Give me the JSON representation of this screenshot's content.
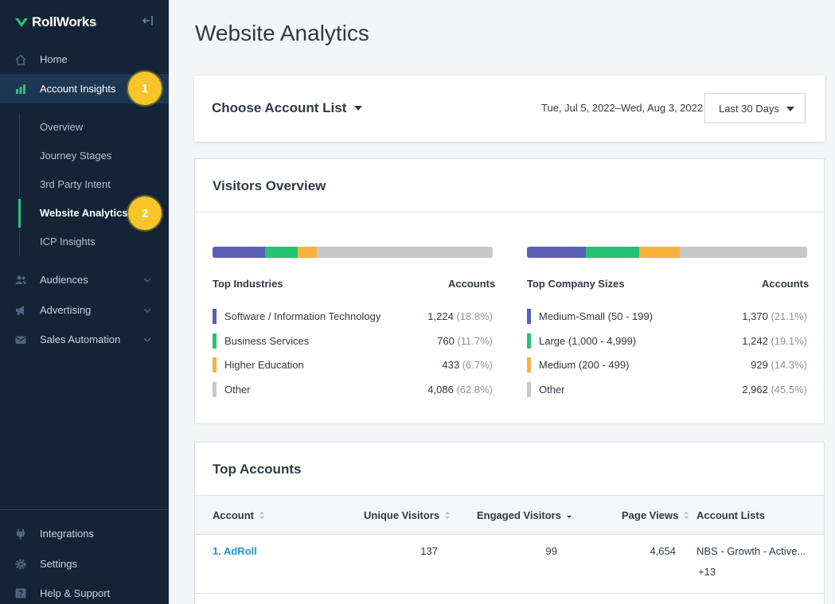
{
  "brand": {
    "name": "RollWorks",
    "accent": "#2ec27e",
    "sidebar_bg": "#142436"
  },
  "sidebar": {
    "items": [
      {
        "label": "Home",
        "icon": "home-icon"
      },
      {
        "label": "Account Insights",
        "icon": "chart-icon"
      },
      {
        "label": "Audiences",
        "icon": "people-icon"
      },
      {
        "label": "Advertising",
        "icon": "megaphone-icon"
      },
      {
        "label": "Sales Automation",
        "icon": "mail-icon"
      }
    ],
    "sub_items": [
      "Overview",
      "Journey Stages",
      "3rd Party Intent",
      "Website Analytics",
      "ICP Insights"
    ],
    "bottom_items": [
      {
        "label": "Integrations",
        "icon": "plug-icon"
      },
      {
        "label": "Settings",
        "icon": "gear-icon"
      },
      {
        "label": "Help & Support",
        "icon": "help-icon"
      }
    ],
    "badges": [
      "1",
      "2"
    ]
  },
  "page": {
    "title": "Website Analytics"
  },
  "filter": {
    "choose_label": "Choose Account List",
    "date_range": "Tue, Jul 5, 2022–Wed, Aug 3, 2022",
    "period": "Last 30 Days"
  },
  "visitors": {
    "title": "Visitors Overview",
    "industries": {
      "header": "Top Industries",
      "col": "Accounts",
      "rows": [
        {
          "label": "Software / Information Technology",
          "value": "1,224",
          "pct": "(18.8%)",
          "share": 18.8,
          "color": "#5b5fb6"
        },
        {
          "label": "Business Services",
          "value": "760",
          "pct": "(11.7%)",
          "share": 11.7,
          "color": "#22c472"
        },
        {
          "label": "Higher Education",
          "value": "433",
          "pct": "(6.7%)",
          "share": 6.7,
          "color": "#f8b23b"
        },
        {
          "label": "Other",
          "value": "4,086",
          "pct": "(62.8%)",
          "share": 62.8,
          "color": "#c8c8c8"
        }
      ]
    },
    "sizes": {
      "header": "Top Company Sizes",
      "col": "Accounts",
      "rows": [
        {
          "label": "Medium-Small (50 - 199)",
          "value": "1,370",
          "pct": "(21.1%)",
          "share": 21.1,
          "color": "#5b5fb6"
        },
        {
          "label": "Large (1,000 - 4,999)",
          "value": "1,242",
          "pct": "(19.1%)",
          "share": 19.1,
          "color": "#22c472"
        },
        {
          "label": "Medium (200 - 499)",
          "value": "929",
          "pct": "(14.3%)",
          "share": 14.3,
          "color": "#f8b23b"
        },
        {
          "label": "Other",
          "value": "2,962",
          "pct": "(45.5%)",
          "share": 45.5,
          "color": "#c8c8c8"
        }
      ]
    }
  },
  "top_accounts": {
    "title": "Top Accounts",
    "columns": [
      "Account",
      "Unique Visitors",
      "Engaged Visitors",
      "Page Views",
      "Account Lists"
    ],
    "rows": [
      {
        "account": "1. AdRoll",
        "unique": "137",
        "engaged": "99",
        "views": "4,654",
        "lists": "NBS - Growth - Active...",
        "more": "+13"
      }
    ]
  }
}
